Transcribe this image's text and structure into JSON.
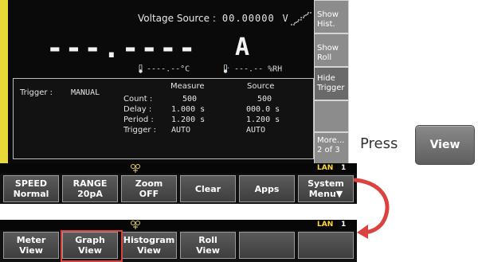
{
  "screen": {
    "voltage_source_label": "Voltage Source :",
    "voltage_source_value": "00.00000",
    "voltage_source_unit": "V",
    "measurement_value": "---.----",
    "measurement_unit": "A",
    "temperature": "----.--°C",
    "humidity": "---.-- %RH"
  },
  "trigger_panel": {
    "trigger_label": "Trigger :",
    "trigger_value": "MANUAL",
    "measure_header": "Measure",
    "source_header": "Source",
    "rows": [
      {
        "label": "Count :",
        "measure": "500",
        "source": "500"
      },
      {
        "label": "Delay :",
        "measure": "1.000 s",
        "source": "000.0 s"
      },
      {
        "label": "Period :",
        "measure": "1.200 s",
        "source": "1.200 s"
      },
      {
        "label": "Trigger :",
        "measure": "AUTO",
        "source": "AUTO"
      }
    ]
  },
  "side_keys": [
    {
      "line1": "Show",
      "line2": "Hist."
    },
    {
      "line1": "Show",
      "line2": "Roll"
    },
    {
      "line1": "Hide",
      "line2": "Trigger"
    },
    {
      "line1": "",
      "line2": ""
    },
    {
      "line1": "More...",
      "line2": "2 of 3"
    }
  ],
  "status_bar": {
    "lan": "LAN",
    "number": "1"
  },
  "softkeys_top": [
    {
      "line1": "SPEED",
      "line2": "Normal"
    },
    {
      "line1": "RANGE",
      "line2": "20pA"
    },
    {
      "line1": "Zoom",
      "line2": "OFF"
    },
    {
      "line1": "Clear",
      "line2": ""
    },
    {
      "line1": "Apps",
      "line2": ""
    },
    {
      "line1": "System",
      "line2": "Menu▼"
    }
  ],
  "softkeys_bottom": [
    {
      "line1": "Meter",
      "line2": "View"
    },
    {
      "line1": "Graph",
      "line2": "View"
    },
    {
      "line1": "Histogram",
      "line2": "View"
    },
    {
      "line1": "Roll",
      "line2": "View"
    },
    {
      "line1": "",
      "line2": ""
    },
    {
      "line1": "",
      "line2": ""
    }
  ],
  "instruction": {
    "press_text": "Press",
    "button_label": "View"
  },
  "colors": {
    "lan": "#ffd832",
    "bezel": "#e8d83a",
    "highlight": "#d9443f",
    "arrow": "#d9443f"
  }
}
